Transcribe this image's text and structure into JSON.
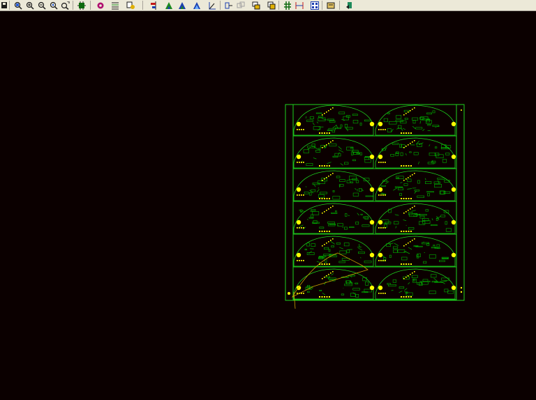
{
  "toolbar": {
    "items": [
      {
        "name": "save-icon"
      },
      {
        "name": "zoom-window-icon"
      },
      {
        "name": "zoom-in-icon"
      },
      {
        "name": "zoom-out-icon"
      },
      {
        "name": "zoom-previous-icon"
      },
      {
        "name": "zoom-all-icon"
      },
      {
        "name": "component-icon"
      },
      {
        "name": "via-icon"
      },
      {
        "name": "layers-icon"
      },
      {
        "name": "properties-icon"
      },
      {
        "name": "align-icon"
      },
      {
        "name": "route-icon"
      },
      {
        "name": "route-diagonal-icon"
      },
      {
        "name": "route-arc-icon"
      },
      {
        "name": "measure-icon"
      },
      {
        "name": "move-icon"
      },
      {
        "name": "copy-icon"
      },
      {
        "name": "rotate-icon"
      },
      {
        "name": "mirror-icon"
      },
      {
        "name": "grid-icon"
      },
      {
        "name": "dimension-icon"
      },
      {
        "name": "array-icon"
      },
      {
        "name": "report-icon"
      },
      {
        "name": "export-icon"
      }
    ]
  },
  "board": {
    "panel_rows": 6,
    "panel_cols": 2,
    "colors": {
      "background": "#0b0000",
      "outline": "#1ed21e",
      "copper": "#00b400",
      "pads": "#ffff00",
      "silk": "#c8a000"
    }
  }
}
